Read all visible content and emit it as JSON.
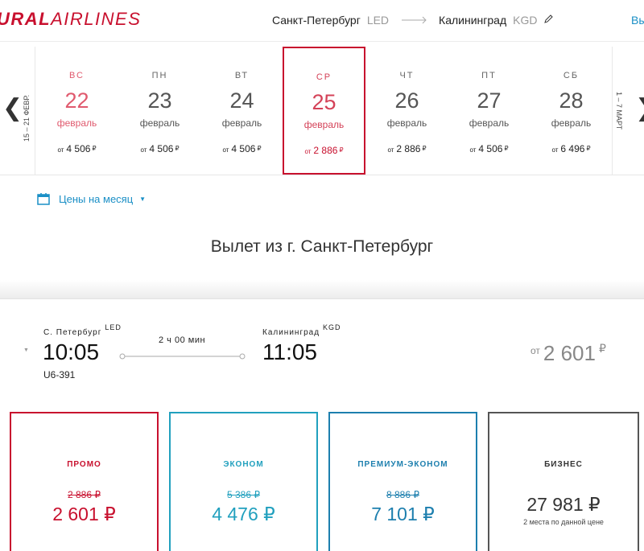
{
  "header": {
    "logo_bold": "URAL",
    "logo_light": "AIRLINES",
    "origin": "Санкт-Петербург",
    "origin_code": "LED",
    "destination": "Калининград",
    "destination_code": "KGD",
    "right_link": "Вы"
  },
  "dates": {
    "prev_week": "15 – 21 ФЕВР.",
    "next_week": "1 – 7 МАРТ",
    "days": [
      {
        "dow": "ВС",
        "day": "22",
        "month": "февраль",
        "price_prefix": "от",
        "price": "4 506",
        "currency": "₽"
      },
      {
        "dow": "ПН",
        "day": "23",
        "month": "февраль",
        "price_prefix": "от",
        "price": "4 506",
        "currency": "₽"
      },
      {
        "dow": "ВТ",
        "day": "24",
        "month": "февраль",
        "price_prefix": "от",
        "price": "4 506",
        "currency": "₽"
      },
      {
        "dow": "СР",
        "day": "25",
        "month": "февраль",
        "price_prefix": "от",
        "price": "2 886",
        "currency": "₽"
      },
      {
        "dow": "ЧТ",
        "day": "26",
        "month": "февраль",
        "price_prefix": "от",
        "price": "2 886",
        "currency": "₽"
      },
      {
        "dow": "ПТ",
        "day": "27",
        "month": "февраль",
        "price_prefix": "от",
        "price": "4 506",
        "currency": "₽"
      },
      {
        "dow": "СБ",
        "day": "28",
        "month": "февраль",
        "price_prefix": "от",
        "price": "6 496",
        "currency": "₽"
      }
    ]
  },
  "month_prices_label": "Цены на месяц",
  "section_title": "Вылет из г. Санкт-Петербург",
  "flight": {
    "from_city": "С. Петербург",
    "from_code": "LED",
    "to_city": "Калининград",
    "to_code": "KGD",
    "departure": "10:05",
    "arrival": "11:05",
    "duration": "2 ч 00 мин",
    "flight_number": "U6-391",
    "price_prefix": "от",
    "price": "2 601",
    "currency": "₽"
  },
  "fares": [
    {
      "name": "ПРОМО",
      "old_price": "2 886 ₽",
      "price": "2 601 ₽"
    },
    {
      "name": "ЭКОНОМ",
      "old_price": "5 386 ₽",
      "price": "4 476 ₽"
    },
    {
      "name": "ПРЕМИУМ-ЭКОНОМ",
      "old_price": "8 886 ₽",
      "price": "7 101 ₽"
    },
    {
      "name": "БИЗНЕС",
      "price": "27 981 ₽",
      "note": "2 места по данной цене"
    }
  ],
  "colors": {
    "brand_red": "#c8102e",
    "link_blue": "#1a8fc6",
    "econ_teal": "#21a0be",
    "premium_blue": "#1d7fae",
    "business_gray": "#555555"
  }
}
